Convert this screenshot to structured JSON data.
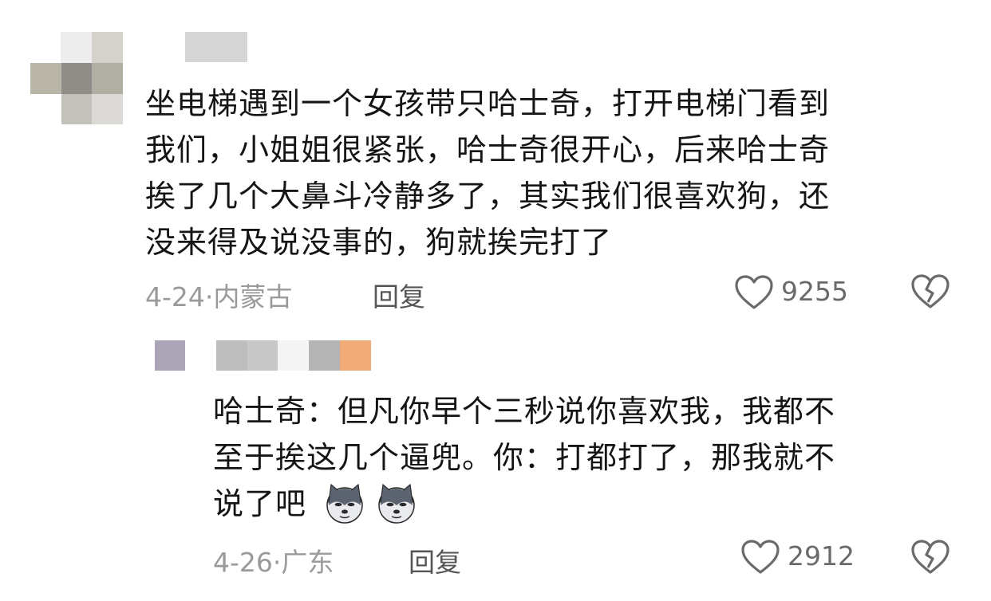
{
  "comments": [
    {
      "text": "坐电梯遇到一个女孩带只哈士奇，打开电梯门看到\n我们，小姐姐很紧张，哈士奇很开心，后来哈士奇\n挨了几个大鼻斗冷静多了，其实我们很喜欢狗，还\n没来得及说没事的，狗就挨完打了",
      "date": "4-24",
      "location": "内蒙古",
      "reply_label": "回复",
      "likes": "9255"
    }
  ],
  "replies": [
    {
      "text": "哈士奇：但凡你早个三秒说你喜欢我，我都不\n至于挨这几个逼兜。你：打都打了，那我就不\n说了吧",
      "emojis": [
        "husky-emoji",
        "husky-emoji"
      ],
      "date": "4-26",
      "location": "广东",
      "reply_label": "回复",
      "likes": "2912"
    }
  ],
  "meta_separator": "·",
  "colors": {
    "text": "#151515",
    "meta": "#9a9a9a",
    "reply": "#555555",
    "icon": "#6a6a6a",
    "pixel_orange": "#f0ab76",
    "pixel_purple": "#aca5b8"
  }
}
